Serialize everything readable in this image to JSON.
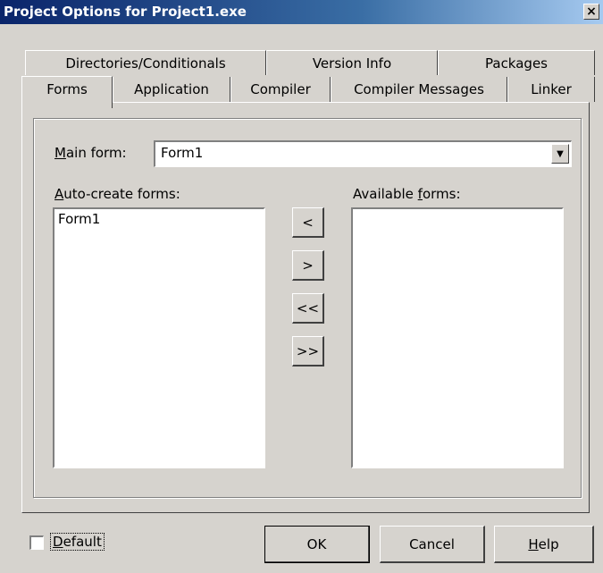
{
  "window": {
    "title": "Project Options for Project1.exe",
    "close_glyph": "×"
  },
  "tabs_back": [
    {
      "label": "Directories/Conditionals"
    },
    {
      "label": "Version Info"
    },
    {
      "label": "Packages"
    }
  ],
  "tabs_front": [
    {
      "label": "Forms",
      "active": true
    },
    {
      "label": "Application"
    },
    {
      "label": "Compiler"
    },
    {
      "label": "Compiler Messages"
    },
    {
      "label": "Linker"
    }
  ],
  "main_form": {
    "label_hotkey": "M",
    "label_rest": "ain form:",
    "value": "Form1",
    "dropdown_icon": "▼"
  },
  "auto_create": {
    "label_hotkey": "A",
    "label_rest": "uto-create forms:",
    "items": [
      "Form1"
    ]
  },
  "available": {
    "label_prefix": "Available ",
    "label_hotkey": "f",
    "label_rest": "orms:",
    "items": []
  },
  "move_buttons": [
    "<",
    ">",
    "<<",
    ">>"
  ],
  "footer": {
    "default_label_hotkey": "D",
    "default_label_rest": "efault",
    "ok_label": "OK",
    "cancel_label": "Cancel",
    "help_hotkey": "H",
    "help_rest": "elp"
  }
}
